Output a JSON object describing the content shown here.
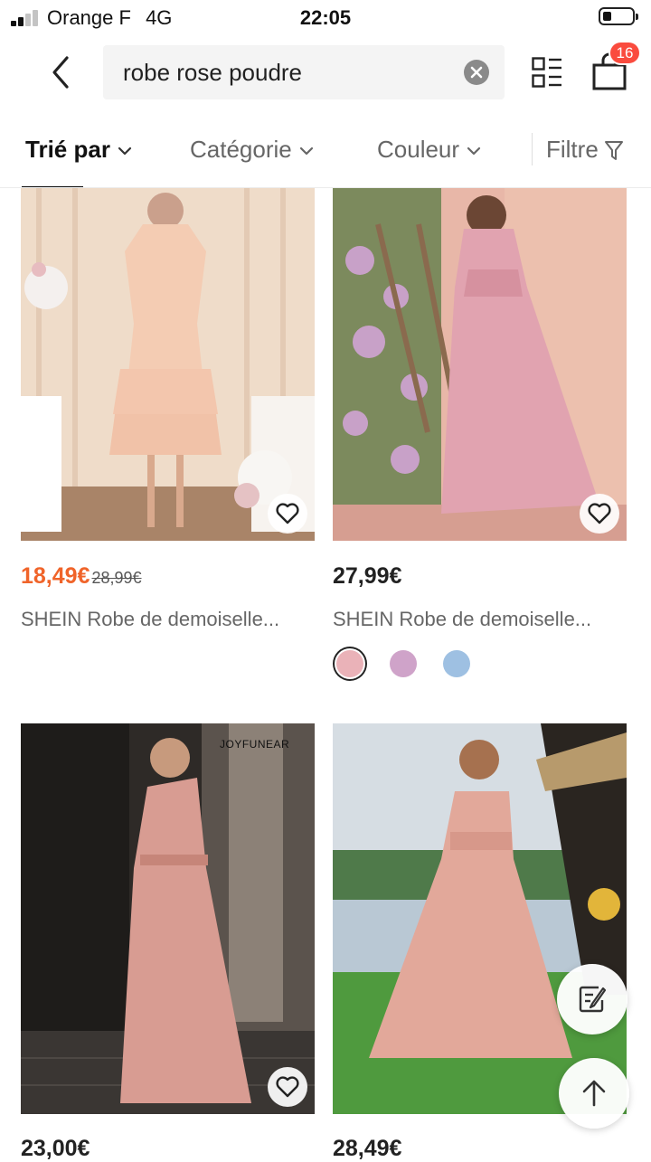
{
  "status_bar": {
    "carrier": "Orange F",
    "network": "4G",
    "time": "22:05"
  },
  "search": {
    "query": "robe rose poudre"
  },
  "cart": {
    "count": "16"
  },
  "filters": {
    "sort_label": "Trié par",
    "category_label": "Catégorie",
    "color_label": "Couleur",
    "filter_label": "Filtre"
  },
  "products": [
    {
      "price": "18,49€",
      "old_price": "28,99€",
      "title": "SHEIN Robe de demoiselle...",
      "image_colors": [
        "#f0d2c0",
        "#e8c0ad"
      ]
    },
    {
      "price": "27,99€",
      "title": "SHEIN Robe de demoiselle...",
      "swatches": [
        "#eab2b8",
        "#cfa3c9",
        "#9ec0e2"
      ],
      "image_colors": [
        "#e9bdb3",
        "#d88f9d"
      ]
    },
    {
      "price": "23,00€",
      "brand_watermark": "JOYFUNEAR",
      "image_colors": [
        "#3a3530",
        "#d99a8f"
      ]
    },
    {
      "price": "28,49€",
      "image_colors": [
        "#cfd8df",
        "#e6a999"
      ]
    }
  ],
  "icons": {
    "back": "chevron-left-icon",
    "clear": "clear-icon",
    "grid": "grid-list-icon",
    "bag": "shopping-bag-icon",
    "favorite": "heart-icon",
    "edit": "edit-note-icon",
    "top": "arrow-up-icon"
  },
  "colors": {
    "sale_price": "#f0642a",
    "badge": "#fa4b3e"
  }
}
